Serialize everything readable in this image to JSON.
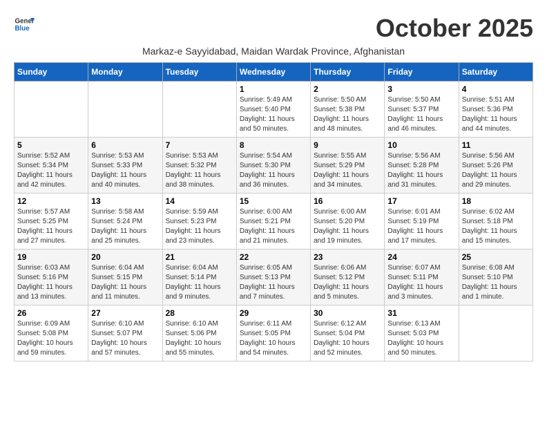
{
  "header": {
    "logo_line1": "General",
    "logo_line2": "Blue",
    "month_title": "October 2025",
    "subtitle": "Markaz-e Sayyidabad, Maidan Wardak Province, Afghanistan"
  },
  "weekdays": [
    "Sunday",
    "Monday",
    "Tuesday",
    "Wednesday",
    "Thursday",
    "Friday",
    "Saturday"
  ],
  "weeks": [
    [
      {
        "day": "",
        "info": ""
      },
      {
        "day": "",
        "info": ""
      },
      {
        "day": "",
        "info": ""
      },
      {
        "day": "1",
        "info": "Sunrise: 5:49 AM\nSunset: 5:40 PM\nDaylight: 11 hours\nand 50 minutes."
      },
      {
        "day": "2",
        "info": "Sunrise: 5:50 AM\nSunset: 5:38 PM\nDaylight: 11 hours\nand 48 minutes."
      },
      {
        "day": "3",
        "info": "Sunrise: 5:50 AM\nSunset: 5:37 PM\nDaylight: 11 hours\nand 46 minutes."
      },
      {
        "day": "4",
        "info": "Sunrise: 5:51 AM\nSunset: 5:36 PM\nDaylight: 11 hours\nand 44 minutes."
      }
    ],
    [
      {
        "day": "5",
        "info": "Sunrise: 5:52 AM\nSunset: 5:34 PM\nDaylight: 11 hours\nand 42 minutes."
      },
      {
        "day": "6",
        "info": "Sunrise: 5:53 AM\nSunset: 5:33 PM\nDaylight: 11 hours\nand 40 minutes."
      },
      {
        "day": "7",
        "info": "Sunrise: 5:53 AM\nSunset: 5:32 PM\nDaylight: 11 hours\nand 38 minutes."
      },
      {
        "day": "8",
        "info": "Sunrise: 5:54 AM\nSunset: 5:30 PM\nDaylight: 11 hours\nand 36 minutes."
      },
      {
        "day": "9",
        "info": "Sunrise: 5:55 AM\nSunset: 5:29 PM\nDaylight: 11 hours\nand 34 minutes."
      },
      {
        "day": "10",
        "info": "Sunrise: 5:56 AM\nSunset: 5:28 PM\nDaylight: 11 hours\nand 31 minutes."
      },
      {
        "day": "11",
        "info": "Sunrise: 5:56 AM\nSunset: 5:26 PM\nDaylight: 11 hours\nand 29 minutes."
      }
    ],
    [
      {
        "day": "12",
        "info": "Sunrise: 5:57 AM\nSunset: 5:25 PM\nDaylight: 11 hours\nand 27 minutes."
      },
      {
        "day": "13",
        "info": "Sunrise: 5:58 AM\nSunset: 5:24 PM\nDaylight: 11 hours\nand 25 minutes."
      },
      {
        "day": "14",
        "info": "Sunrise: 5:59 AM\nSunset: 5:23 PM\nDaylight: 11 hours\nand 23 minutes."
      },
      {
        "day": "15",
        "info": "Sunrise: 6:00 AM\nSunset: 5:21 PM\nDaylight: 11 hours\nand 21 minutes."
      },
      {
        "day": "16",
        "info": "Sunrise: 6:00 AM\nSunset: 5:20 PM\nDaylight: 11 hours\nand 19 minutes."
      },
      {
        "day": "17",
        "info": "Sunrise: 6:01 AM\nSunset: 5:19 PM\nDaylight: 11 hours\nand 17 minutes."
      },
      {
        "day": "18",
        "info": "Sunrise: 6:02 AM\nSunset: 5:18 PM\nDaylight: 11 hours\nand 15 minutes."
      }
    ],
    [
      {
        "day": "19",
        "info": "Sunrise: 6:03 AM\nSunset: 5:16 PM\nDaylight: 11 hours\nand 13 minutes."
      },
      {
        "day": "20",
        "info": "Sunrise: 6:04 AM\nSunset: 5:15 PM\nDaylight: 11 hours\nand 11 minutes."
      },
      {
        "day": "21",
        "info": "Sunrise: 6:04 AM\nSunset: 5:14 PM\nDaylight: 11 hours\nand 9 minutes."
      },
      {
        "day": "22",
        "info": "Sunrise: 6:05 AM\nSunset: 5:13 PM\nDaylight: 11 hours\nand 7 minutes."
      },
      {
        "day": "23",
        "info": "Sunrise: 6:06 AM\nSunset: 5:12 PM\nDaylight: 11 hours\nand 5 minutes."
      },
      {
        "day": "24",
        "info": "Sunrise: 6:07 AM\nSunset: 5:11 PM\nDaylight: 11 hours\nand 3 minutes."
      },
      {
        "day": "25",
        "info": "Sunrise: 6:08 AM\nSunset: 5:10 PM\nDaylight: 11 hours\nand 1 minute."
      }
    ],
    [
      {
        "day": "26",
        "info": "Sunrise: 6:09 AM\nSunset: 5:08 PM\nDaylight: 10 hours\nand 59 minutes."
      },
      {
        "day": "27",
        "info": "Sunrise: 6:10 AM\nSunset: 5:07 PM\nDaylight: 10 hours\nand 57 minutes."
      },
      {
        "day": "28",
        "info": "Sunrise: 6:10 AM\nSunset: 5:06 PM\nDaylight: 10 hours\nand 55 minutes."
      },
      {
        "day": "29",
        "info": "Sunrise: 6:11 AM\nSunset: 5:05 PM\nDaylight: 10 hours\nand 54 minutes."
      },
      {
        "day": "30",
        "info": "Sunrise: 6:12 AM\nSunset: 5:04 PM\nDaylight: 10 hours\nand 52 minutes."
      },
      {
        "day": "31",
        "info": "Sunrise: 6:13 AM\nSunset: 5:03 PM\nDaylight: 10 hours\nand 50 minutes."
      },
      {
        "day": "",
        "info": ""
      }
    ]
  ]
}
